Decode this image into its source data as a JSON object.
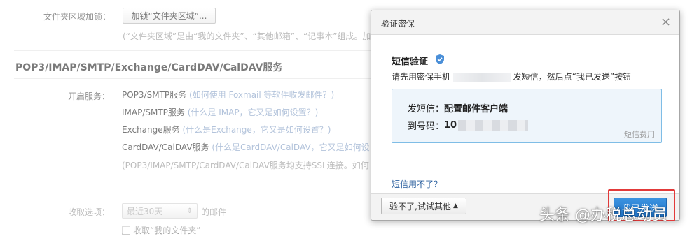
{
  "folder_lock": {
    "label": "文件夹区域加锁：",
    "button": "加锁“文件夹区域”...",
    "note": "(“文件夹区域”是由“我的文件夹”、“其他邮箱”、“记事本”组成。加锁"
  },
  "section_title": "POP3/IMAP/SMTP/Exchange/CardDAV/CalDAV服务",
  "services": {
    "label": "开启服务：",
    "items": [
      {
        "name": "POP3/SMTP服务",
        "help": "(如何使用 Foxmail 等软件收发邮件？)"
      },
      {
        "name": "IMAP/SMTP服务",
        "help": "(什么是 IMAP，它又是如何设置？)"
      },
      {
        "name": "Exchange服务",
        "help": "(什么是Exchange，它又是如何设置？)"
      },
      {
        "name": "CardDAV/CalDAV服务",
        "help": "(什么是CardDAV/CalDAV，它又是如何设"
      }
    ],
    "ssl_note": "(POP3/IMAP/SMTP/CardDAV/CalDAV服务均支持SSL连接。如何"
  },
  "receive": {
    "label": "收取选项：",
    "select_value": "最近30天",
    "suffix": "的邮件",
    "checkbox_label": "收取“我的文件夹”"
  },
  "dialog": {
    "title": "验证密保",
    "close": "×",
    "heading": "短信验证",
    "instruction_prefix": "请先用密保手机",
    "instruction_suffix": "发短信，然后点“我已发送”按钮",
    "send_label": "发短信：",
    "send_value": "配置邮件客户端",
    "to_label": "到号码：",
    "to_value": "10",
    "fee": "短信费用",
    "cant_use": "短信用不了？",
    "other_button": "验不了,试试其他",
    "confirm_button": "我已发送"
  },
  "watermark": "头条 @办税总动员",
  "colors": {
    "primary": "#2a80d2",
    "highlight": "#e23a3a",
    "sms_border": "#7fbde6"
  }
}
